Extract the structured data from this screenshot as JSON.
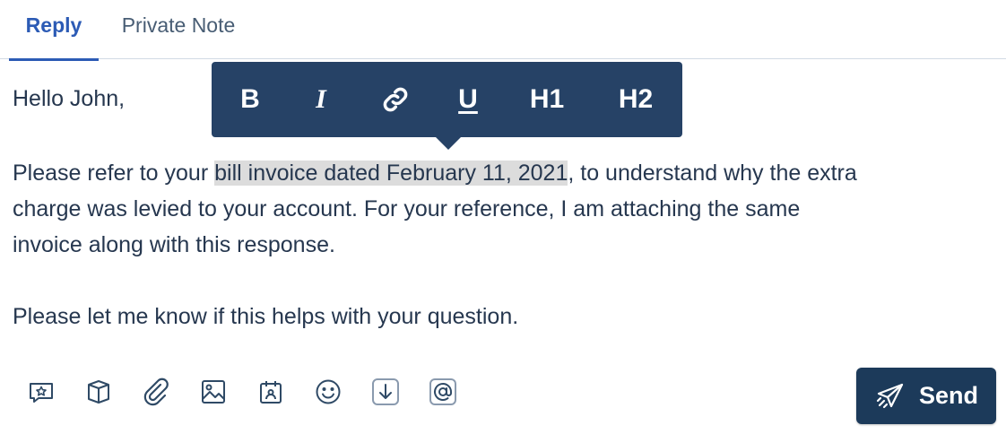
{
  "tabs": [
    {
      "label": "Reply",
      "active": true
    },
    {
      "label": "Private Note",
      "active": false
    }
  ],
  "editor": {
    "greeting": "Hello John,",
    "para1_before": "Please refer to your ",
    "para1_highlight": "bill invoice dated February 11, 2021",
    "para1_after": ", to understand why the extra",
    "para1_line2": "charge was levied to your account. For your reference, I am attaching the same",
    "para1_line3": "invoice along with this response.",
    "para2": "Please let me know if this helps with your question."
  },
  "format_toolbar": {
    "bold": "B",
    "italic": "I",
    "link_icon": "link-icon",
    "underline": "U",
    "h1": "H1",
    "h2": "H2"
  },
  "bottom_toolbar": {
    "icons": [
      "canned-response-icon",
      "knowledge-base-icon",
      "attachment-icon",
      "image-icon",
      "calendar-icon",
      "emoji-icon",
      "download-icon",
      "mention-icon"
    ]
  },
  "send_button": {
    "label": "Send",
    "icon": "paper-plane-icon"
  },
  "colors": {
    "accent": "#2c5bb5",
    "toolbar_bg": "#264266",
    "send_bg": "#1c3a5a",
    "text": "#26374f",
    "highlight": "#dcdcdc"
  }
}
